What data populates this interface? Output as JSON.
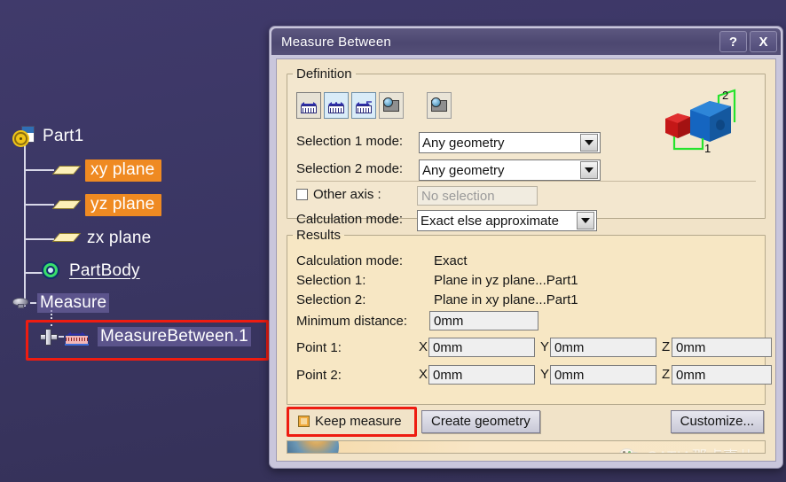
{
  "viewport": {
    "background_color": "#3a3663"
  },
  "spec_tree": {
    "nodes": [
      {
        "label": "Part1",
        "icon": "part-document-icon",
        "style": "plain"
      },
      {
        "label": "xy plane",
        "icon": "plane-icon",
        "style": "highlighted"
      },
      {
        "label": "yz plane",
        "icon": "plane-icon",
        "style": "highlighted"
      },
      {
        "label": "zx plane",
        "icon": "plane-icon",
        "style": "plain"
      },
      {
        "label": "PartBody",
        "icon": "partbody-gear-icon",
        "style": "underlined"
      },
      {
        "label": "Measure",
        "icon": "measure-node-icon",
        "style": "soft-selected"
      },
      {
        "label": "MeasureBetween.1",
        "icon": "measure-between-icon",
        "style": "soft-selected"
      }
    ],
    "highlight_color": "#ef8a22",
    "annotation_color": "#ee1c11"
  },
  "dialog": {
    "title": "Measure Between",
    "help_button": "?",
    "close_button": "X",
    "definition": {
      "legend": "Definition",
      "toolbar": [
        {
          "name": "measure-between-tool",
          "selected": false
        },
        {
          "name": "measure-between-chain-tool",
          "selected": true
        },
        {
          "name": "measure-between-fan-tool",
          "selected": false
        },
        {
          "name": "measure-item-tool",
          "selected": false
        },
        {
          "name": "measure-thickness-tool",
          "selected": false
        }
      ],
      "preview": {
        "label_1": "1",
        "label_2": "2"
      },
      "selection1_mode_label": "Selection 1 mode:",
      "selection1_mode_value": "Any geometry",
      "selection2_mode_label": "Selection 2 mode:",
      "selection2_mode_value": "Any geometry",
      "other_axis_label": "Other axis :",
      "other_axis_checked": false,
      "other_axis_placeholder": "No selection",
      "calculation_mode_label": "Calculation mode:",
      "calculation_mode_value": "Exact else approximate"
    },
    "results": {
      "legend": "Results",
      "rows": [
        {
          "label": "Calculation mode:",
          "value": "Exact"
        },
        {
          "label": "Selection 1:",
          "value": "Plane in yz plane...Part1"
        },
        {
          "label": "Selection 2:",
          "value": "Plane in xy plane...Part1"
        }
      ],
      "minimum_distance_label": "Minimum distance:",
      "minimum_distance_value": "0mm",
      "point1_label": "Point 1:",
      "point2_label": "Point 2:",
      "axis_x": "X",
      "axis_y": "Y",
      "axis_z": "Z",
      "point1": {
        "x": "0mm",
        "y": "0mm",
        "z": "0mm"
      },
      "point2": {
        "x": "0mm",
        "y": "0mm",
        "z": "0mm"
      }
    },
    "bottom": {
      "keep_measure_label": "Keep measure",
      "keep_measure_checked": true,
      "create_geometry_label": "Create geometry",
      "customize_label": "Customize..."
    },
    "watermark": {
      "text": "CATIA那点事儿",
      "icon": "wechat-icon"
    }
  }
}
